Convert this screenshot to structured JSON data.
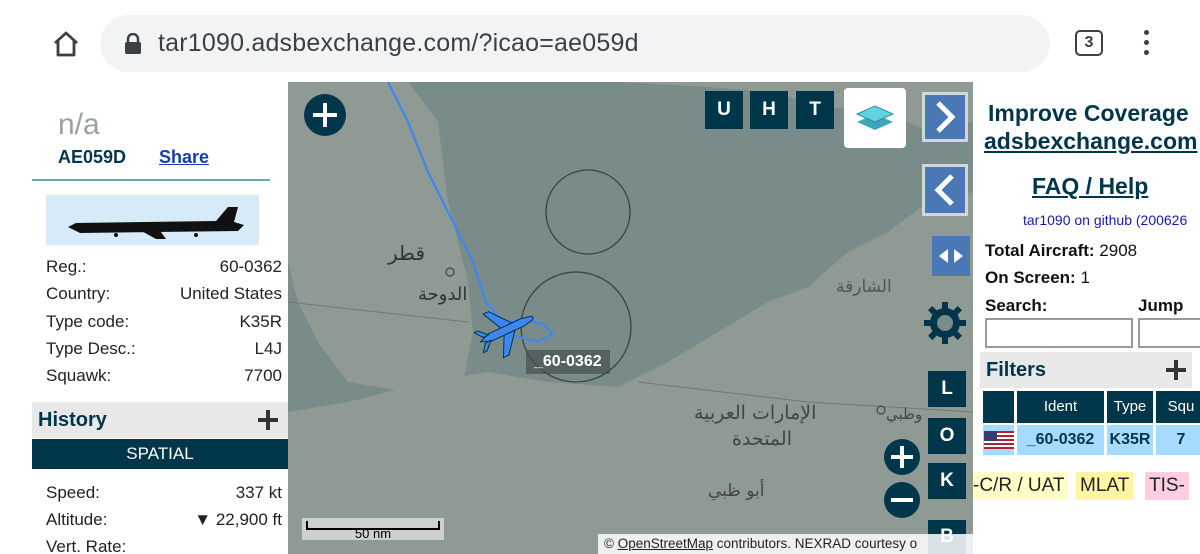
{
  "browser": {
    "url": "tar1090.adsbexchange.com/?icao=ae059d",
    "tab_count": "3"
  },
  "aircraft": {
    "name": "n/a",
    "icao": "AE059D",
    "share_label": "Share",
    "fields": [
      {
        "key": "Reg.:",
        "value": "60-0362"
      },
      {
        "key": "Country:",
        "value": "United States"
      },
      {
        "key": "Type code:",
        "value": "K35R"
      },
      {
        "key": "Type Desc.:",
        "value": "L4J"
      },
      {
        "key": "Squawk:",
        "value": "7700"
      }
    ],
    "history_label": "History",
    "spatial_label": "SPATIAL",
    "spatial_fields": [
      {
        "key": "Speed:",
        "value": "337 kt"
      },
      {
        "key": "Altitude:",
        "value": "▼ 22,900 ft"
      },
      {
        "key": "Vert. Rate:",
        "value": ""
      }
    ]
  },
  "map": {
    "toggle_buttons": [
      "U",
      "H",
      "T"
    ],
    "side_buttons": [
      "L",
      "O",
      "K",
      "B"
    ],
    "callsign_label": "_60-0362",
    "scale_label": "50 nm",
    "attribution_prefix": "© ",
    "attribution_link": "OpenStreetMap",
    "attribution_suffix": " contributors. NEXRAD courtesy o",
    "place_labels": {
      "qatar": "قطر",
      "doha": "الدوحة",
      "sharjah": "الشارقة",
      "uae_line1": "الإمارات العربية",
      "uae_line2": "المتحدة",
      "abudhabi": "أبو ظبي",
      "abudhabi_partial": "وظبي"
    },
    "colors": {
      "water": "#7a8c89",
      "land": "#9aa49f",
      "track": "#3f86f2",
      "aircraft": "#3f86f2",
      "button": "#00364a",
      "nav_button": "#4a78b5"
    }
  },
  "right": {
    "improve_label": "Improve Coverage",
    "adsbx_label": "adsbexchange.com",
    "faq_label": "FAQ / Help",
    "github_label": "tar1090 on github (200626",
    "total_label": "Total Aircraft:",
    "total_value": "2908",
    "onscreen_label": "On Screen:",
    "onscreen_value": "1",
    "search_label": "Search:",
    "jump_label": "Jump",
    "filters_label": "Filters",
    "table_headers": [
      "Ident",
      "Type",
      "Squ"
    ],
    "table_row": {
      "ident": "_60-0362",
      "type": "K35R",
      "squawk": "7"
    },
    "legend": [
      {
        "label": "-C/R / UAT",
        "color": "#ffffc8"
      },
      {
        "label": "MLAT",
        "color": "#fff5a0"
      },
      {
        "label": "TIS-",
        "color": "#ffcde0"
      }
    ]
  }
}
